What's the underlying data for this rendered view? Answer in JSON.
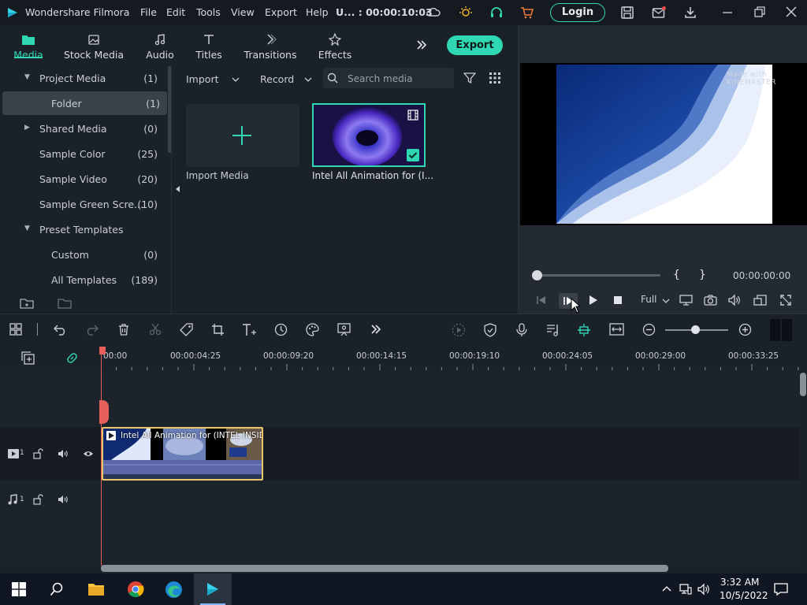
{
  "app": {
    "title": "Wondershare Filmora",
    "menu": [
      "File",
      "Edit",
      "Tools",
      "View",
      "Export",
      "Help"
    ],
    "project_status": "U... : 00:00:10:03",
    "login_label": "Login"
  },
  "media_tabs": {
    "tabs": [
      {
        "label": "Media",
        "icon": "folder-icon",
        "active": true
      },
      {
        "label": "Stock Media",
        "icon": "stock-media-icon",
        "active": false
      },
      {
        "label": "Audio",
        "icon": "music-note-icon",
        "active": false
      },
      {
        "label": "Titles",
        "icon": "text-t-icon",
        "active": false
      },
      {
        "label": "Transitions",
        "icon": "transitions-icon",
        "active": false
      },
      {
        "label": "Effects",
        "icon": "effects-icon",
        "active": false
      }
    ],
    "export_label": "Export"
  },
  "library": {
    "items": [
      {
        "label": "Project Media",
        "count": "(1)",
        "expanded": true
      },
      {
        "label": "Folder",
        "count": "(1)",
        "selected": true
      },
      {
        "label": "Shared Media",
        "count": "(0)",
        "expanded": false
      },
      {
        "label": "Sample Color",
        "count": "(25)"
      },
      {
        "label": "Sample Video",
        "count": "(20)"
      },
      {
        "label": "Sample Green Scre...",
        "count": "(10)"
      },
      {
        "label": "Preset Templates",
        "count": "",
        "expanded": true
      },
      {
        "label": "Custom",
        "count": "(0)"
      },
      {
        "label": "All Templates",
        "count": "(189)"
      }
    ]
  },
  "media_bar": {
    "import_label": "Import",
    "record_label": "Record",
    "search_placeholder": "Search media"
  },
  "media_items": [
    {
      "label": "Import Media"
    },
    {
      "label": "Intel All Animation for (I..."
    }
  ],
  "preview": {
    "watermark": "Made with KINEMASTER",
    "timecode": "00:00:00:00",
    "mark_in": "{",
    "mark_out": "}",
    "quality": "Full"
  },
  "timeline": {
    "ruler": [
      "00:00",
      "00:00:04:25",
      "00:00:09:20",
      "00:00:14:15",
      "00:00:19:10",
      "00:00:24:05",
      "00:00:29:00",
      "00:00:33:25"
    ],
    "video_track_num": "1",
    "audio_track_num": "1",
    "clip_title": "Intel All Animation for (INTEL INSID..."
  },
  "taskbar": {
    "time": "3:32 AM",
    "date": "10/5/2022"
  },
  "colors": {
    "accent": "#2fd7b3",
    "playhead": "#e5605a",
    "clip_border": "#e8c56a"
  }
}
